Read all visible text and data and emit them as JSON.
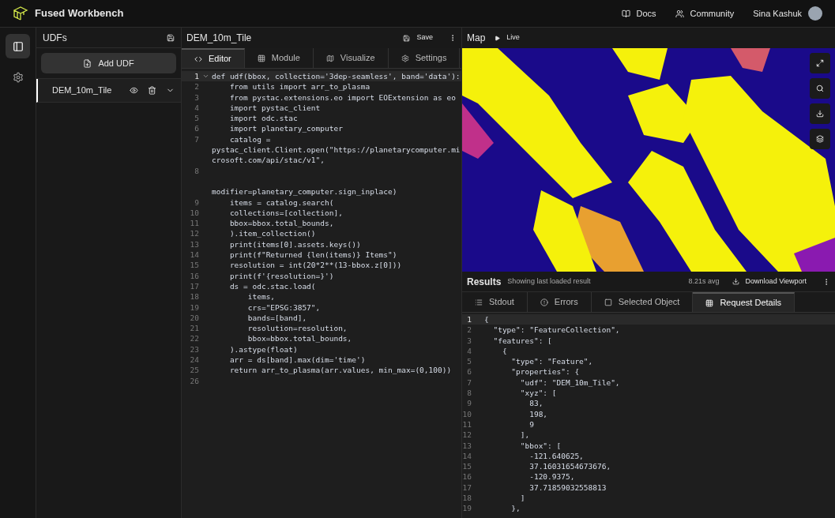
{
  "header": {
    "title": "Fused Workbench",
    "links": [
      {
        "label": "Docs"
      },
      {
        "label": "Community"
      }
    ],
    "user": "Sina Kashuk"
  },
  "rail": [
    {
      "selected": true
    },
    {
      "selected": false
    }
  ],
  "udf_panel": {
    "title": "UDFs",
    "add_button": "Add UDF",
    "items": [
      {
        "name": "DEM_10m_Tile",
        "selected": true
      }
    ]
  },
  "editor": {
    "title": "DEM_10m_Tile",
    "save": "Save",
    "tabs": [
      {
        "label": "Editor",
        "selected": true
      },
      {
        "label": "Module",
        "selected": false
      },
      {
        "label": "Visualize",
        "selected": false
      },
      {
        "label": "Settings",
        "selected": false
      }
    ],
    "lines": [
      {
        "number": "1",
        "text": "def udf(bbox, collection='3dep-seamless', band='data'):",
        "current": true,
        "kind": "fold"
      },
      {
        "number": "2",
        "text": "    from utils import arr_to_plasma",
        "current": false
      },
      {
        "number": "3",
        "text": "    from pystac.extensions.eo import EOExtension as eo",
        "current": false
      },
      {
        "number": "4",
        "text": "    import pystac_client",
        "current": false
      },
      {
        "number": "5",
        "text": "    import odc.stac",
        "current": false
      },
      {
        "number": "6",
        "text": "    import planetary_computer",
        "current": false
      },
      {
        "number": "7",
        "text": "    catalog =",
        "current": false,
        "wrapped": [
          "pystac_client.Client.open(\"https://planetarycomputer.mi",
          "crosoft.com/api/stac/v1\","
        ]
      },
      {
        "number": "8",
        "current": false,
        "kind": "gap",
        "wrapped": [
          "modifier=planetary_computer.sign_inplace)"
        ]
      },
      {
        "number": "9",
        "text": "    items = catalog.search(",
        "current": false
      },
      {
        "number": "10",
        "text": "    collections=[collection],",
        "current": false
      },
      {
        "number": "11",
        "text": "    bbox=bbox.total_bounds,",
        "current": false
      },
      {
        "number": "12",
        "text": "    ).item_collection()",
        "current": false
      },
      {
        "number": "13",
        "text": "    print(items[0].assets.keys())",
        "current": false
      },
      {
        "number": "14",
        "text": "    print(f\"Returned {len(items)} Items\")",
        "current": false
      },
      {
        "number": "15",
        "text": "    resolution = int(20*2**(13-bbox.z[0]))",
        "current": false
      },
      {
        "number": "16",
        "text": "    print(f'{resolution=}')",
        "current": false
      },
      {
        "number": "17",
        "text": "    ds = odc.stac.load(",
        "current": false
      },
      {
        "number": "18",
        "text": "        items,",
        "current": false
      },
      {
        "number": "19",
        "text": "        crs=\"EPSG:3857\",",
        "current": false
      },
      {
        "number": "20",
        "text": "        bands=[band],",
        "current": false
      },
      {
        "number": "21",
        "text": "        resolution=resolution,",
        "current": false
      },
      {
        "number": "22",
        "text": "        bbox=bbox.total_bounds,",
        "current": false
      },
      {
        "number": "23",
        "text": "    ).astype(float)",
        "current": false
      },
      {
        "number": "24",
        "text": "    arr = ds[band].max(dim='time')",
        "current": false
      },
      {
        "number": "25",
        "text": "    return arr_to_plasma(arr.values, min_max=(0,100))",
        "current": false
      },
      {
        "number": "26",
        "current": false,
        "kind": "empty"
      }
    ]
  },
  "map": {
    "title": "Map",
    "live": "Live"
  },
  "results": {
    "title": "Results",
    "subtitle": "Showing last loaded result",
    "timing": "8.21s avg",
    "download": "Download Viewport",
    "tabs": [
      {
        "label": "Stdout",
        "selected": false
      },
      {
        "label": "Errors",
        "selected": false
      },
      {
        "label": "Selected Object",
        "selected": false
      },
      {
        "label": "Request Details",
        "selected": true
      }
    ],
    "lines": [
      {
        "number": "1",
        "text": "{",
        "current": true
      },
      {
        "number": "2",
        "text": "  \"type\": \"FeatureCollection\",",
        "current": false
      },
      {
        "number": "3",
        "text": "  \"features\": [",
        "current": false
      },
      {
        "number": "4",
        "text": "    {",
        "current": false
      },
      {
        "number": "5",
        "text": "      \"type\": \"Feature\",",
        "current": false
      },
      {
        "number": "6",
        "text": "      \"properties\": {",
        "current": false
      },
      {
        "number": "7",
        "text": "        \"udf\": \"DEM_10m_Tile\",",
        "current": false
      },
      {
        "number": "8",
        "text": "        \"xyz\": [",
        "current": false
      },
      {
        "number": "9",
        "text": "          83,",
        "current": false
      },
      {
        "number": "10",
        "text": "          198,",
        "current": false
      },
      {
        "number": "11",
        "text": "          9",
        "current": false
      },
      {
        "number": "12",
        "text": "        ],",
        "current": false
      },
      {
        "number": "13",
        "text": "        \"bbox\": [",
        "current": false
      },
      {
        "number": "14",
        "text": "          -121.640625,",
        "current": false
      },
      {
        "number": "15",
        "text": "          37.16031654673676,",
        "current": false
      },
      {
        "number": "16",
        "text": "          -120.9375,",
        "current": false
      },
      {
        "number": "17",
        "text": "          37.71859032558813",
        "current": false
      },
      {
        "number": "18",
        "text": "        ]",
        "current": false
      },
      {
        "number": "19",
        "text": "      },",
        "current": false
      }
    ]
  }
}
